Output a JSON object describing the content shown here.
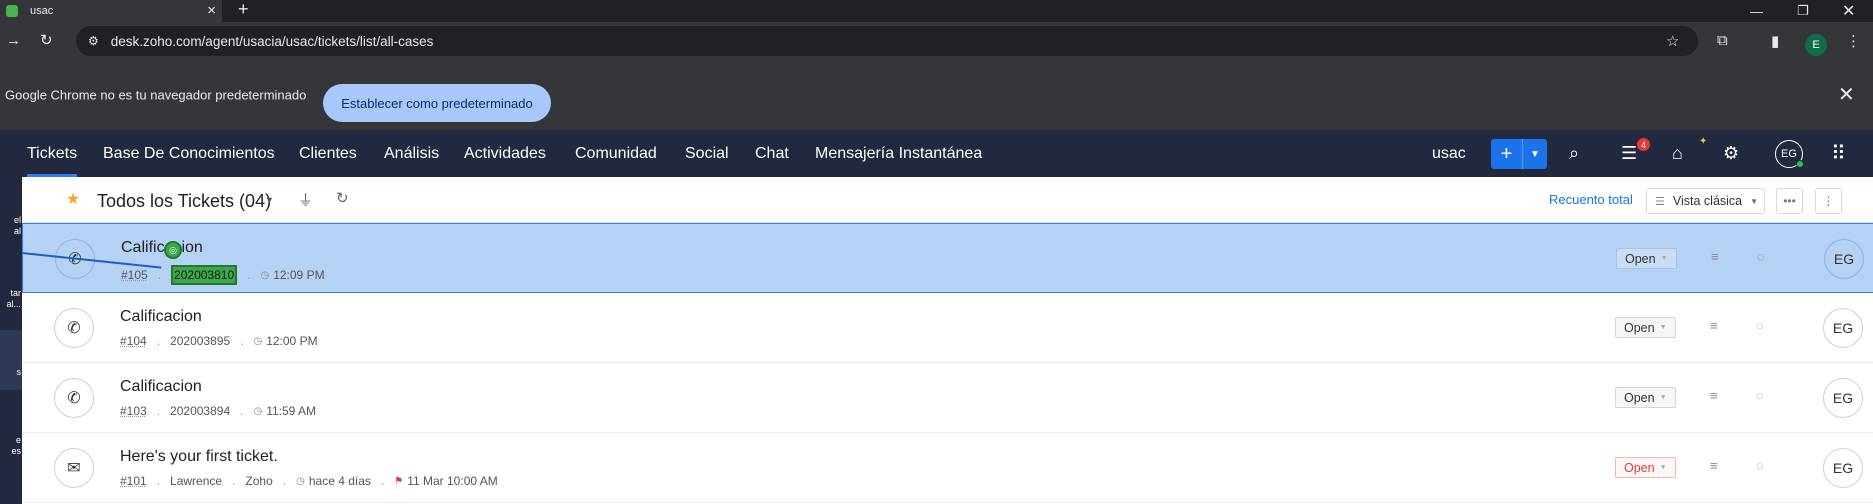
{
  "browser": {
    "tab_title": "usac",
    "url": "desk.zoho.com/agent/usacia/usac/tickets/list/all-cases",
    "profile_initial": "E",
    "infobar": {
      "message": "Google Chrome no es tu navegador predeterminado",
      "button": "Establecer como predeterminado"
    }
  },
  "nav": {
    "items": [
      "Tickets",
      "Base De Conocimientos",
      "Clientes",
      "Análisis",
      "Actividades",
      "Comunidad",
      "Social",
      "Chat",
      "Mensajería Instantánea"
    ],
    "active": "Tickets",
    "portal": "usac",
    "notification_count": "4",
    "user_initials": "EG"
  },
  "sidebar": {
    "labels": [
      "el",
      "al",
      "tar",
      "al...",
      "s",
      "e",
      "es"
    ]
  },
  "list_header": {
    "view_title": "Todos los Tickets (04)",
    "recuento": "Recuento total",
    "view_mode": "Vista clásica"
  },
  "tickets": [
    {
      "subject": "Calificacion",
      "number": "#105",
      "contact": "202003810",
      "time": "12:09 PM",
      "status": "Open",
      "assignee": "EG",
      "channel": "phone",
      "selected": true
    },
    {
      "subject": "Calificacion",
      "number": "#104",
      "contact": "202003895",
      "time": "12:00 PM",
      "status": "Open",
      "assignee": "EG",
      "channel": "phone"
    },
    {
      "subject": "Calificacion",
      "number": "#103",
      "contact": "202003894",
      "time": "11:59 AM",
      "status": "Open",
      "assignee": "EG",
      "channel": "phone"
    },
    {
      "subject": "Here's your first ticket.",
      "number": "#101",
      "contact": "Lawrence",
      "account": "Zoho",
      "time": "hace 4 días",
      "due": "11 Mar 10:00 AM",
      "status": "Open",
      "assignee": "EG",
      "channel": "email",
      "overdue": true
    }
  ],
  "colors": {
    "nav_bg": "#22283d",
    "accent": "#1a73e8",
    "selected_row": "#b5d1f4",
    "highlight": "#3ba74a",
    "overdue": "#e53935"
  }
}
